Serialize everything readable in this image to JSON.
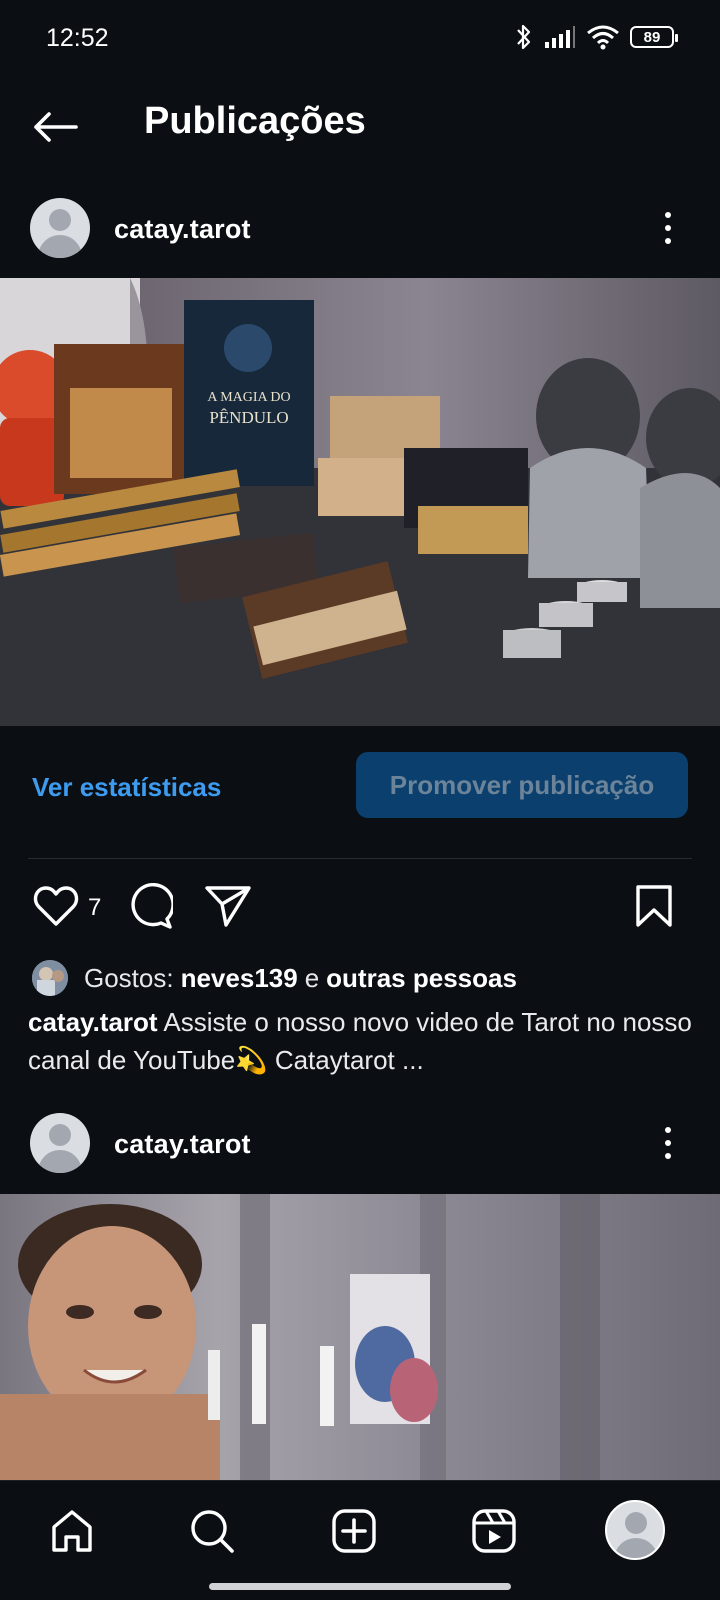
{
  "status_bar": {
    "time": "12:52",
    "battery": "89"
  },
  "header": {
    "title": "Publicações"
  },
  "posts": [
    {
      "username": "catay.tarot"
    },
    {
      "username": "catay.tarot"
    }
  ],
  "post_actions": {
    "insights_label": "Ver estatísticas",
    "promote_label": "Promover publicação",
    "like_count": "7"
  },
  "likes": {
    "prefix": "Gostos:",
    "first_user": "neves139",
    "connector": "e",
    "others": "outras pessoas"
  },
  "caption": {
    "username": "catay.tarot",
    "text": "Assiste o nosso novo video de Tarot no nosso canal de YouTube💫 Cataytarot ..."
  },
  "icons": {
    "back": "arrow-left-icon",
    "more": "more-vertical-icon",
    "like": "heart-icon",
    "comment": "comment-icon",
    "share": "send-icon",
    "save": "bookmark-icon",
    "nav": [
      "home-icon",
      "search-icon",
      "add-icon",
      "reels-icon",
      "profile-avatar"
    ]
  }
}
